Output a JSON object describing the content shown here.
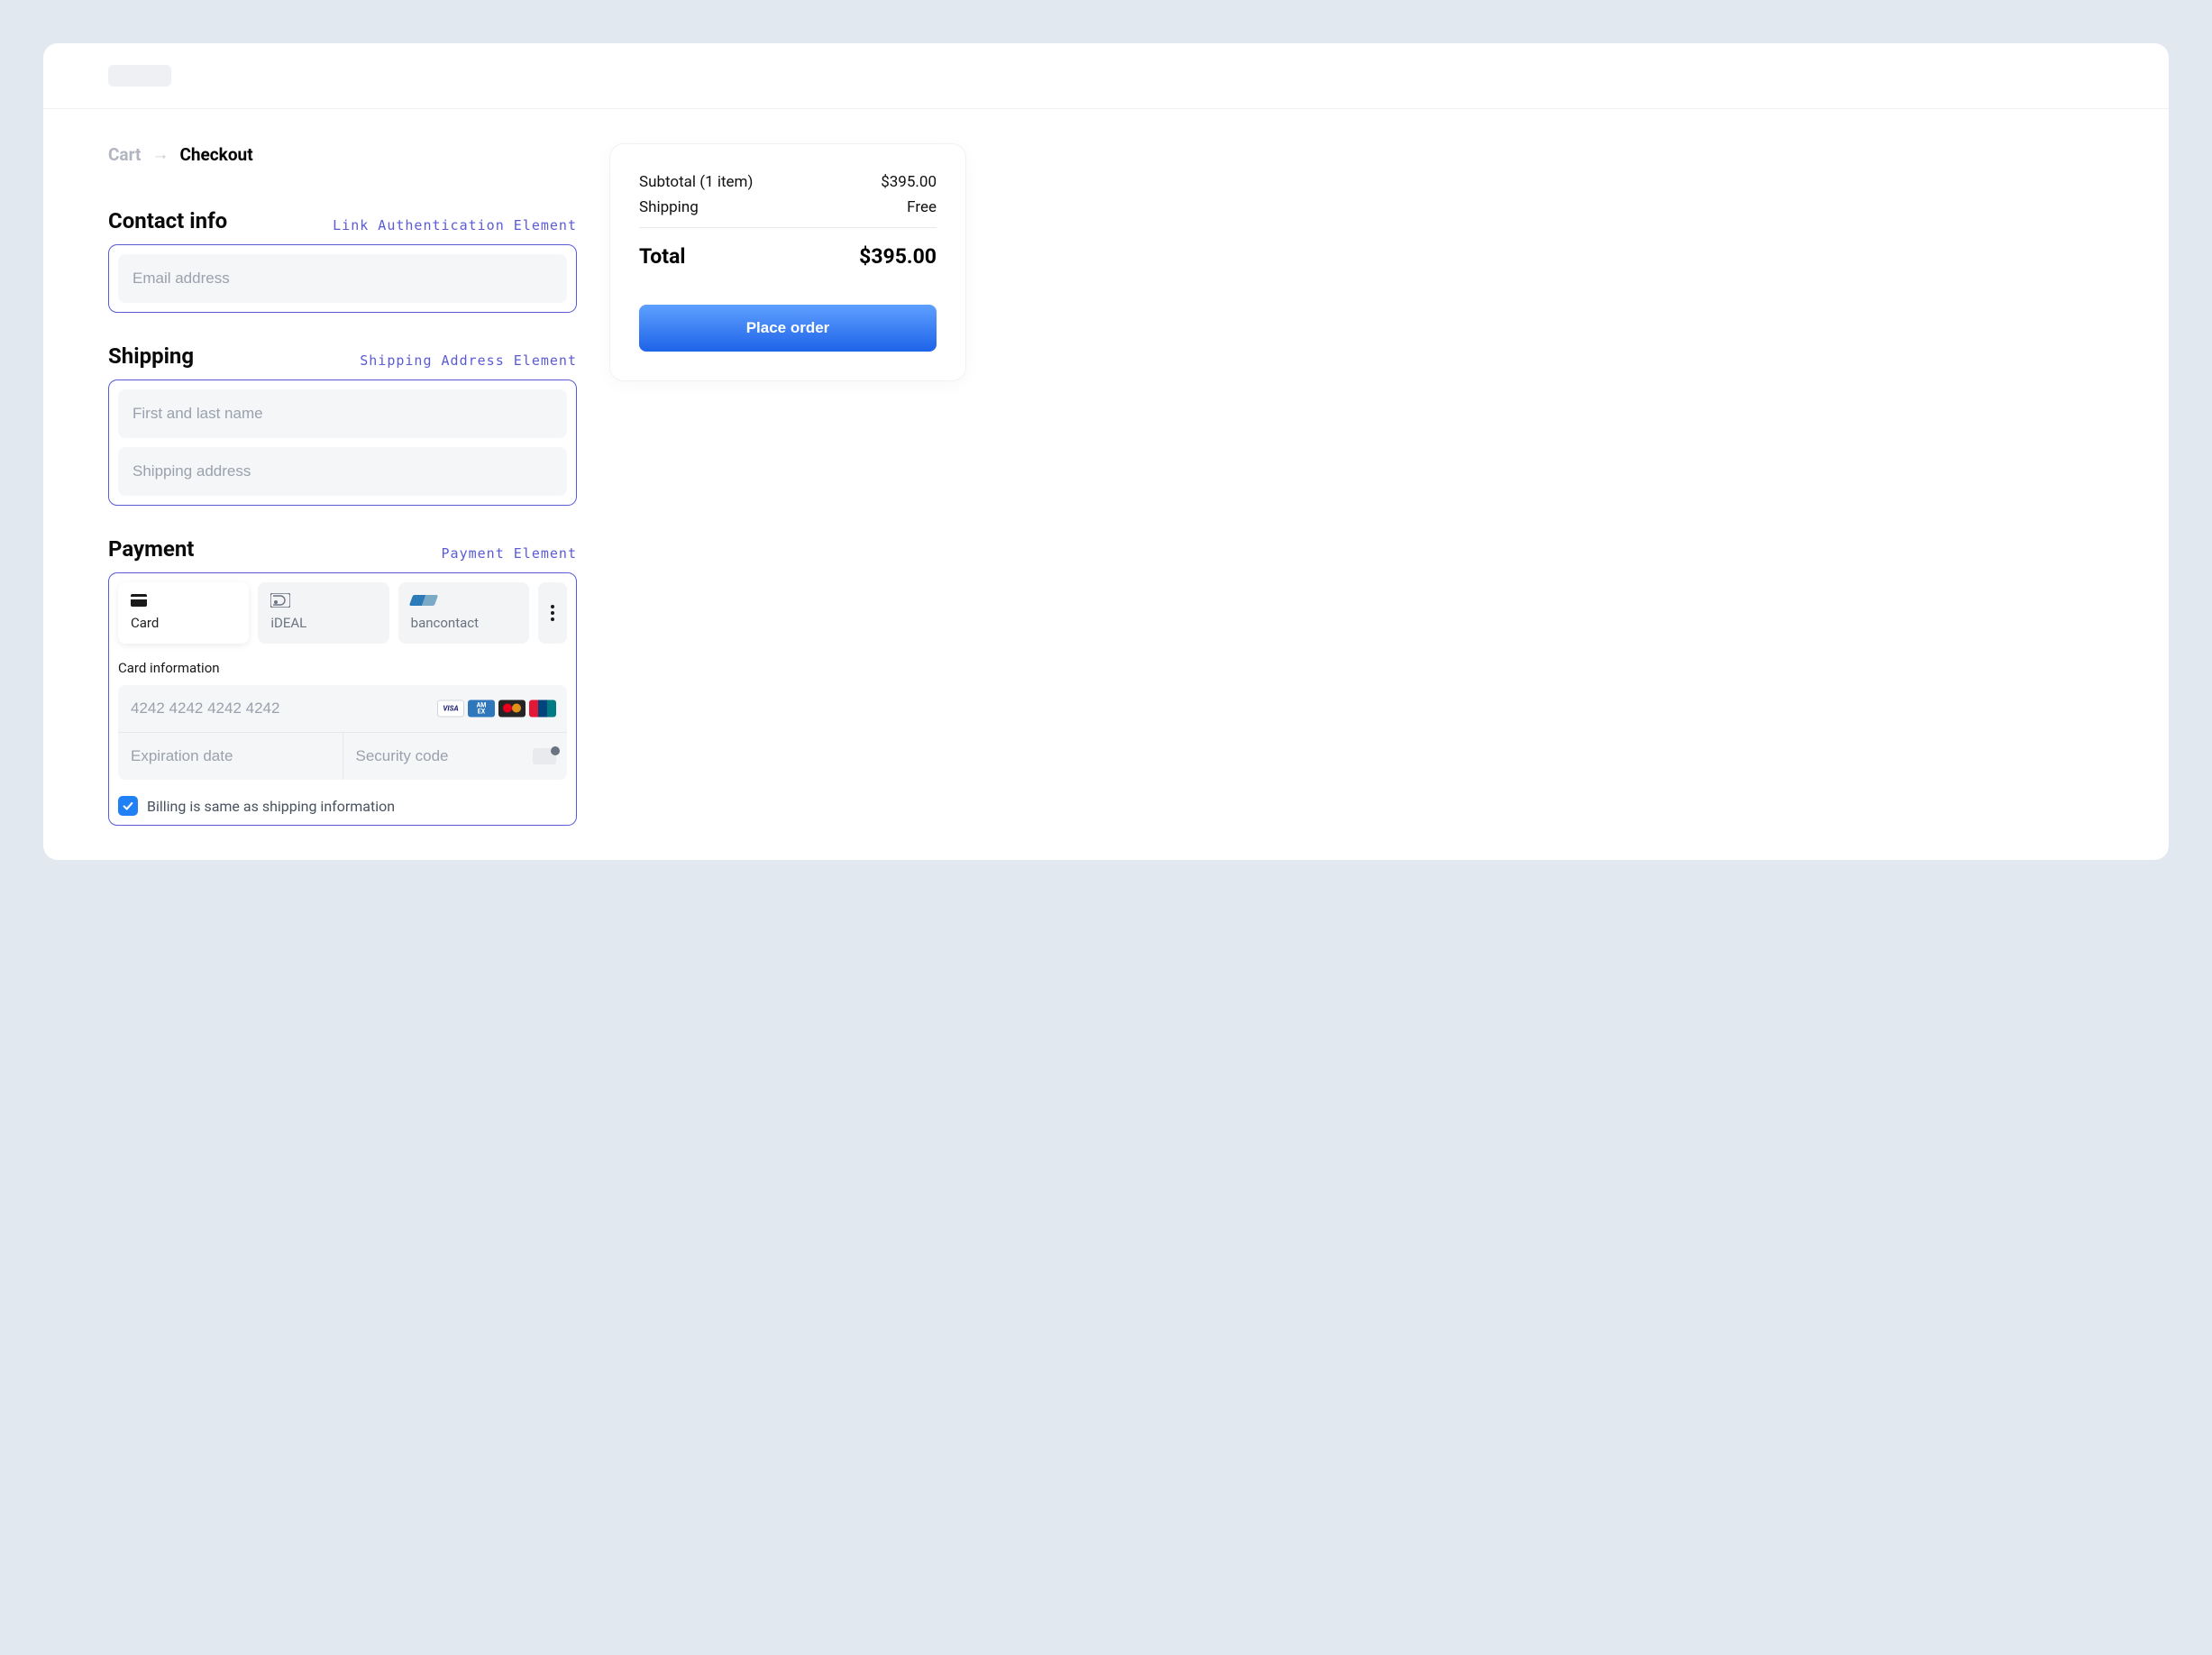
{
  "breadcrumb": {
    "cart": "Cart",
    "checkout": "Checkout"
  },
  "sections": {
    "contact": {
      "title": "Contact info",
      "element_label": "Link Authentication Element",
      "email_placeholder": "Email address"
    },
    "shipping": {
      "title": "Shipping",
      "element_label": "Shipping Address Element",
      "name_placeholder": "First and last name",
      "address_placeholder": "Shipping address"
    },
    "payment": {
      "title": "Payment",
      "element_label": "Payment Element",
      "tabs": {
        "card": "Card",
        "ideal": "iDEAL",
        "bancontact": "bancontact"
      },
      "card_info_label": "Card information",
      "card_number_placeholder": "4242 4242 4242 4242",
      "exp_placeholder": "Expiration date",
      "cvc_placeholder": "Security code",
      "billing_same_label": "Billing is same as shipping information",
      "billing_same_checked": true,
      "card_brands": [
        "visa",
        "amex",
        "mastercard",
        "unionpay"
      ]
    }
  },
  "summary": {
    "subtotal_label": "Subtotal (1 item)",
    "subtotal_value": "$395.00",
    "shipping_label": "Shipping",
    "shipping_value": "Free",
    "total_label": "Total",
    "total_value": "$395.00",
    "place_order_label": "Place order"
  }
}
